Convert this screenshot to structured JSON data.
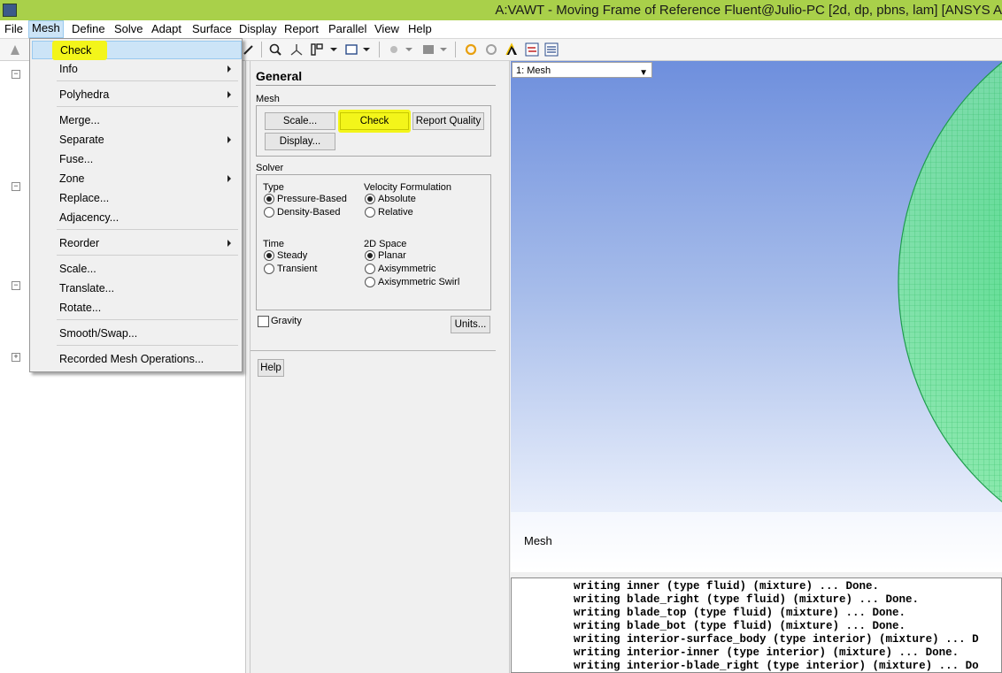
{
  "window": {
    "title": "A:VAWT - Moving Frame of Reference Fluent@Julio-PC  [2d, dp, pbns, lam] [ANSYS A"
  },
  "menubar": [
    "File",
    "Mesh",
    "Define",
    "Solve",
    "Adapt",
    "Surface",
    "Display",
    "Report",
    "Parallel",
    "View",
    "Help"
  ],
  "mesh_menu": {
    "items": [
      "Check",
      "Info",
      "Polyhedra",
      "Merge...",
      "Separate",
      "Fuse...",
      "Zone",
      "Replace...",
      "Adjacency...",
      "Reorder",
      "Scale...",
      "Translate...",
      "Rotate...",
      "Smooth/Swap...",
      "Recorded Mesh Operations..."
    ],
    "submenus": [
      "Info",
      "Polyhedra",
      "Separate",
      "Zone",
      "Reorder"
    ]
  },
  "general": {
    "title": "General",
    "mesh_group": "Mesh",
    "scale_btn": "Scale...",
    "check_btn": "Check",
    "report_btn": "Report Quality",
    "display_btn": "Display...",
    "solver_group": "Solver",
    "type_label": "Type",
    "type_options": [
      "Pressure-Based",
      "Density-Based"
    ],
    "type_selected": "Pressure-Based",
    "velocity_label": "Velocity Formulation",
    "velocity_options": [
      "Absolute",
      "Relative"
    ],
    "velocity_selected": "Absolute",
    "time_label": "Time",
    "time_options": [
      "Steady",
      "Transient"
    ],
    "time_selected": "Steady",
    "space_label": "2D Space",
    "space_options": [
      "Planar",
      "Axisymmetric",
      "Axisymmetric Swirl"
    ],
    "space_selected": "Planar",
    "gravity_label": "Gravity",
    "gravity_checked": false,
    "units_btn": "Units...",
    "help_btn": "Help"
  },
  "graphics": {
    "selector": "1: Mesh",
    "label": "Mesh"
  },
  "console": {
    "lines": [
      "writing inner (type fluid) (mixture) ... Done.",
      "writing blade_right (type fluid) (mixture) ... Done.",
      "writing blade_top (type fluid) (mixture) ... Done.",
      "writing blade_bot (type fluid) (mixture) ... Done.",
      "writing interior-surface_body (type interior) (mixture) ... D",
      "writing interior-inner (type interior) (mixture) ... Done.",
      "writing interior-blade_right (type interior) (mixture) ... Do"
    ]
  },
  "colors": {
    "titlebar": "#a9d04a",
    "highlight": "#f3f51a",
    "menu_hover": "#cce4f7",
    "mesh": "#3ad66a"
  }
}
